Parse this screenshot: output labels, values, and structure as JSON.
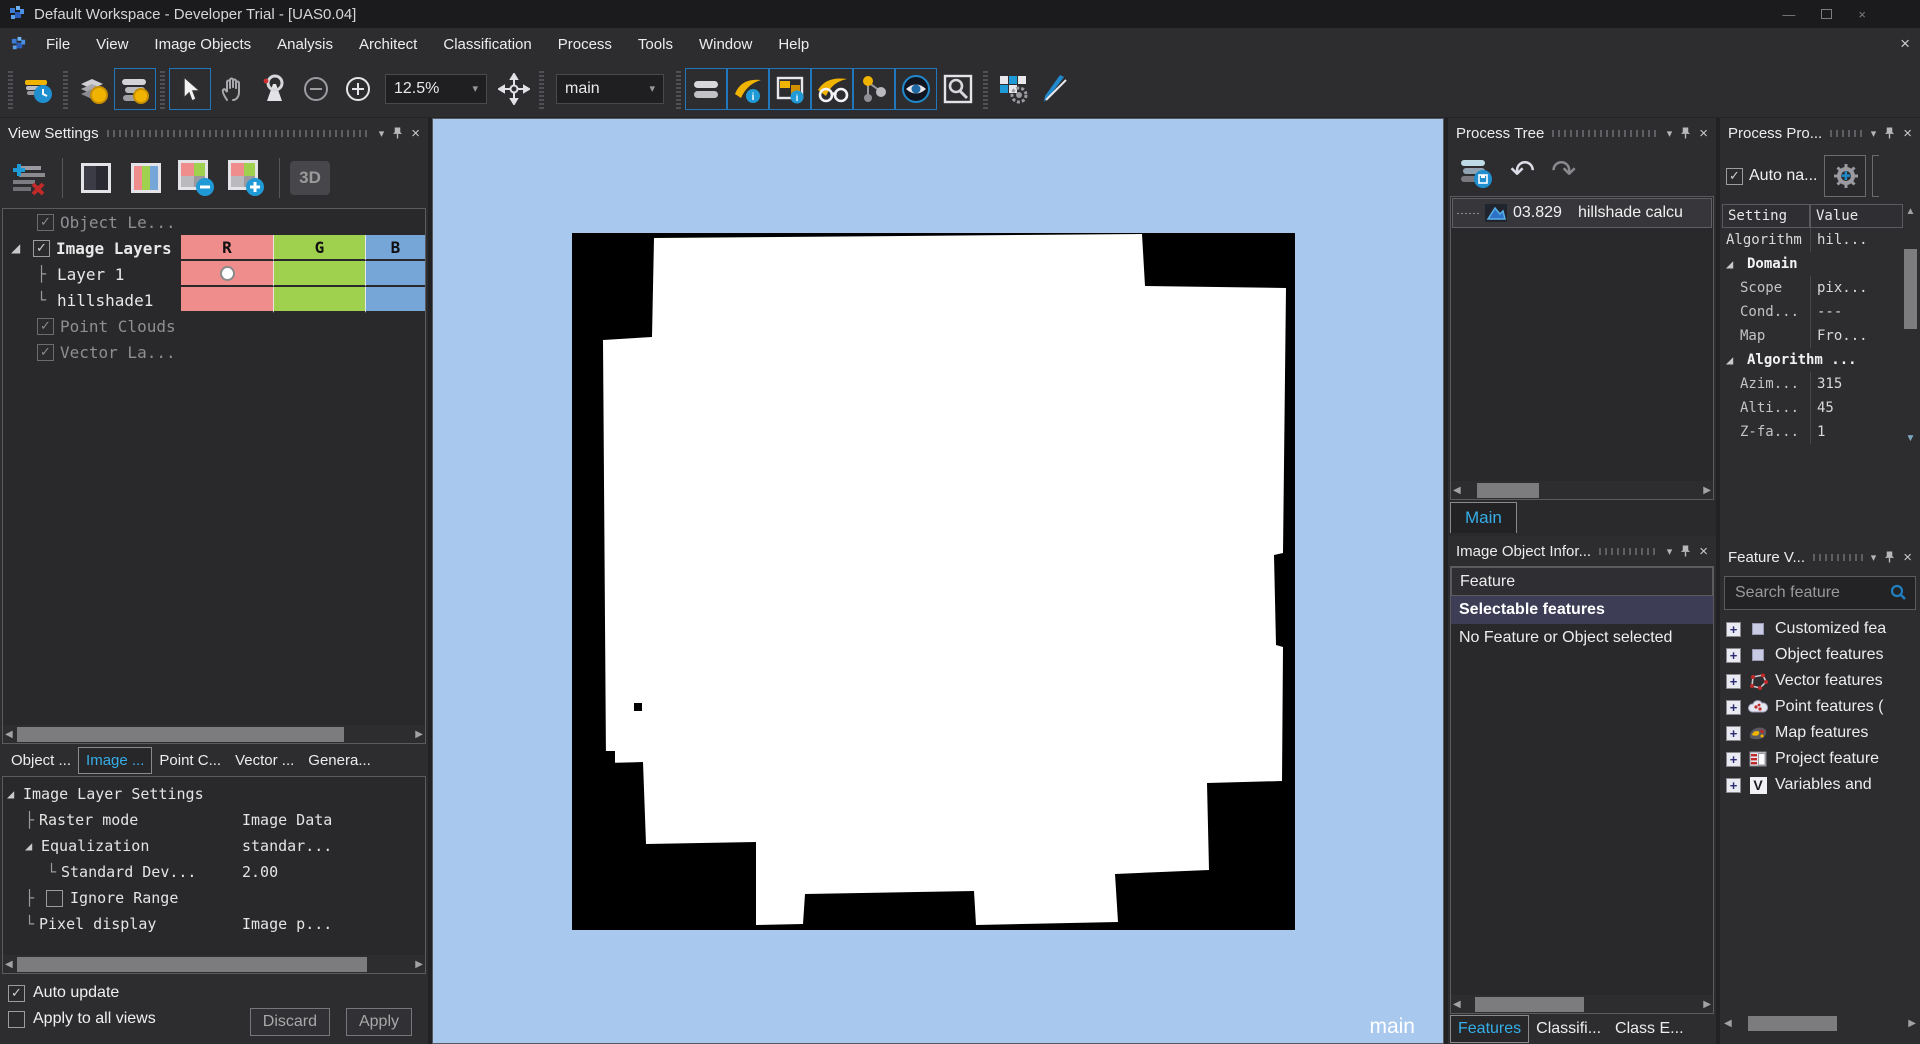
{
  "window": {
    "title": "Default Workspace - Developer Trial - [UAS0.04]"
  },
  "menubar": {
    "items": [
      "File",
      "View",
      "Image Objects",
      "Analysis",
      "Architect",
      "Classification",
      "Process",
      "Tools",
      "Window",
      "Help"
    ]
  },
  "toolbar": {
    "zoom_value": "12.5%",
    "view_value": "main"
  },
  "icons": {
    "dropdown": "▾",
    "close": "×",
    "minimize": "—",
    "check": "✓",
    "expanded": "◢",
    "plus": "+",
    "left_arrow": "◀",
    "right_arrow": "▶",
    "up_arrow": "▲",
    "down_arrow": "▼",
    "undo": "↶",
    "redo": "↷",
    "tree_tee": "├",
    "tree_elbow": "└"
  },
  "colors": {
    "accent_blue": "#35aee8",
    "canvas_bg": "#a8c8ee",
    "column_r": "#ef8c8c",
    "column_g": "#9fd14f",
    "column_b": "#76a5d8",
    "selection_row": "#3d3d56",
    "active_border": "#2277bb"
  },
  "view_settings": {
    "title": "View Settings",
    "button_3d": "3D",
    "columns": {
      "r": "R",
      "g": "G",
      "b": "B"
    },
    "layers": {
      "object_levels": "Object Le...",
      "image_layers": "Image Layers",
      "layer1": "Layer 1",
      "hillshade": "hillshade1",
      "point_clouds": "Point Clouds",
      "vector_layers": "Vector La..."
    },
    "tabs": [
      "Object ...",
      "Image ...",
      "Point C...",
      "Vector ...",
      "Genera..."
    ],
    "settings_tree": {
      "root": "Image Layer Settings",
      "raster_mode_label": "Raster mode",
      "raster_mode_value": "Image Data",
      "equalization_label": "Equalization",
      "equalization_value": "standar...",
      "stddev_label": "Standard Dev...",
      "stddev_value": "2.00",
      "ignore_range_label": "Ignore Range",
      "pixel_display_label": "Pixel display",
      "pixel_display_value": "Image p..."
    },
    "footer": {
      "auto_update": "Auto update",
      "apply_all_views": "Apply to all views",
      "discard": "Discard",
      "apply": "Apply"
    }
  },
  "canvas": {
    "view_label": "main"
  },
  "process_tree": {
    "title": "Process Tree",
    "item_number": "03.829",
    "item_label": "hillshade calcu",
    "tab_main": "Main"
  },
  "image_object_info": {
    "title": "Image Object Infor...",
    "column_header": "Feature",
    "row_selected": "Selectable features",
    "row_empty": "No Feature or Object selected",
    "tabs": [
      "Features",
      "Classifi...",
      "Class E..."
    ]
  },
  "process_properties": {
    "title": "Process Pro...",
    "auto_name_label": "Auto na...",
    "col_setting": "Setting",
    "col_value": "Value",
    "rows": [
      {
        "s": "Algorithm",
        "v": "hil..."
      },
      {
        "s": "Domain",
        "v": ""
      },
      {
        "s": "Scope",
        "v": "pix..."
      },
      {
        "s": "Cond...",
        "v": "---"
      },
      {
        "s": "Map",
        "v": "Fro..."
      },
      {
        "s": "Algorithm ...",
        "v": ""
      },
      {
        "s": "Azim...",
        "v": "315"
      },
      {
        "s": "Alti...",
        "v": "45"
      },
      {
        "s": "Z-fa...",
        "v": "1"
      }
    ]
  },
  "feature_view": {
    "title": "Feature V...",
    "search_placeholder": "Search feature",
    "items": [
      "Customized fea",
      "Object features",
      "Vector features",
      "Point features (",
      "Map features",
      "Project feature",
      "Variables and"
    ]
  }
}
